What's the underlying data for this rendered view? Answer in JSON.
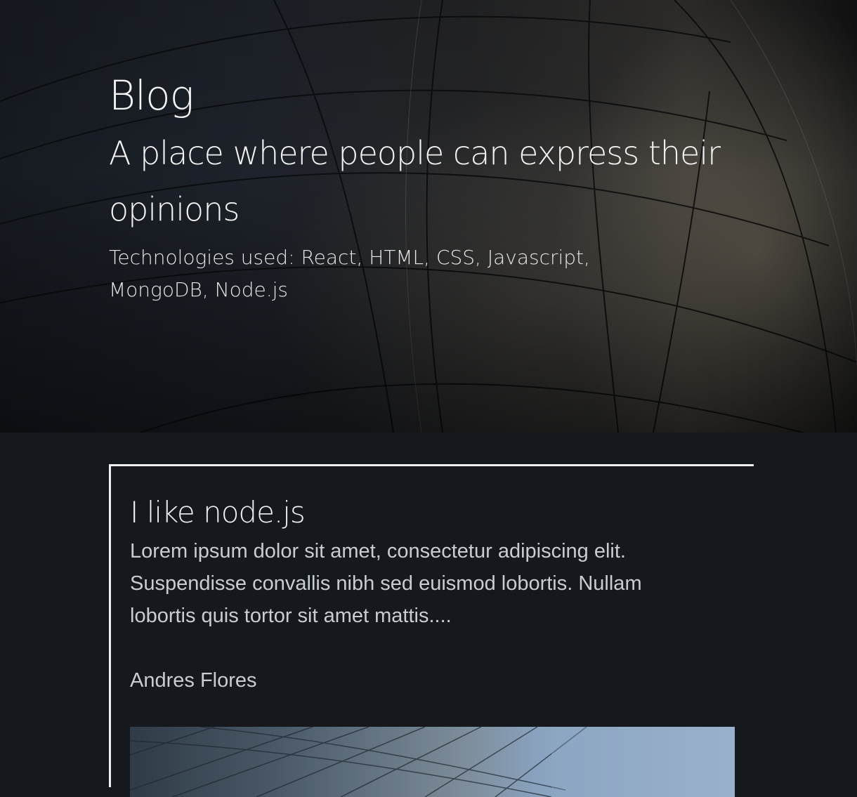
{
  "hero": {
    "title": "Blog",
    "subtitle": "A place where people can express their opinions",
    "technologies": "Technologies used: React, HTML, CSS, Javascript, MongoDB, Node.js"
  },
  "post": {
    "title": "I like node.js",
    "excerpt": "Lorem ipsum dolor sit amet, consectetur adipiscing elit. Suspendisse convallis nibh sed euismod lobortis. Nullam lobortis quis tortor sit amet mattis....",
    "author": "Andres Flores"
  }
}
